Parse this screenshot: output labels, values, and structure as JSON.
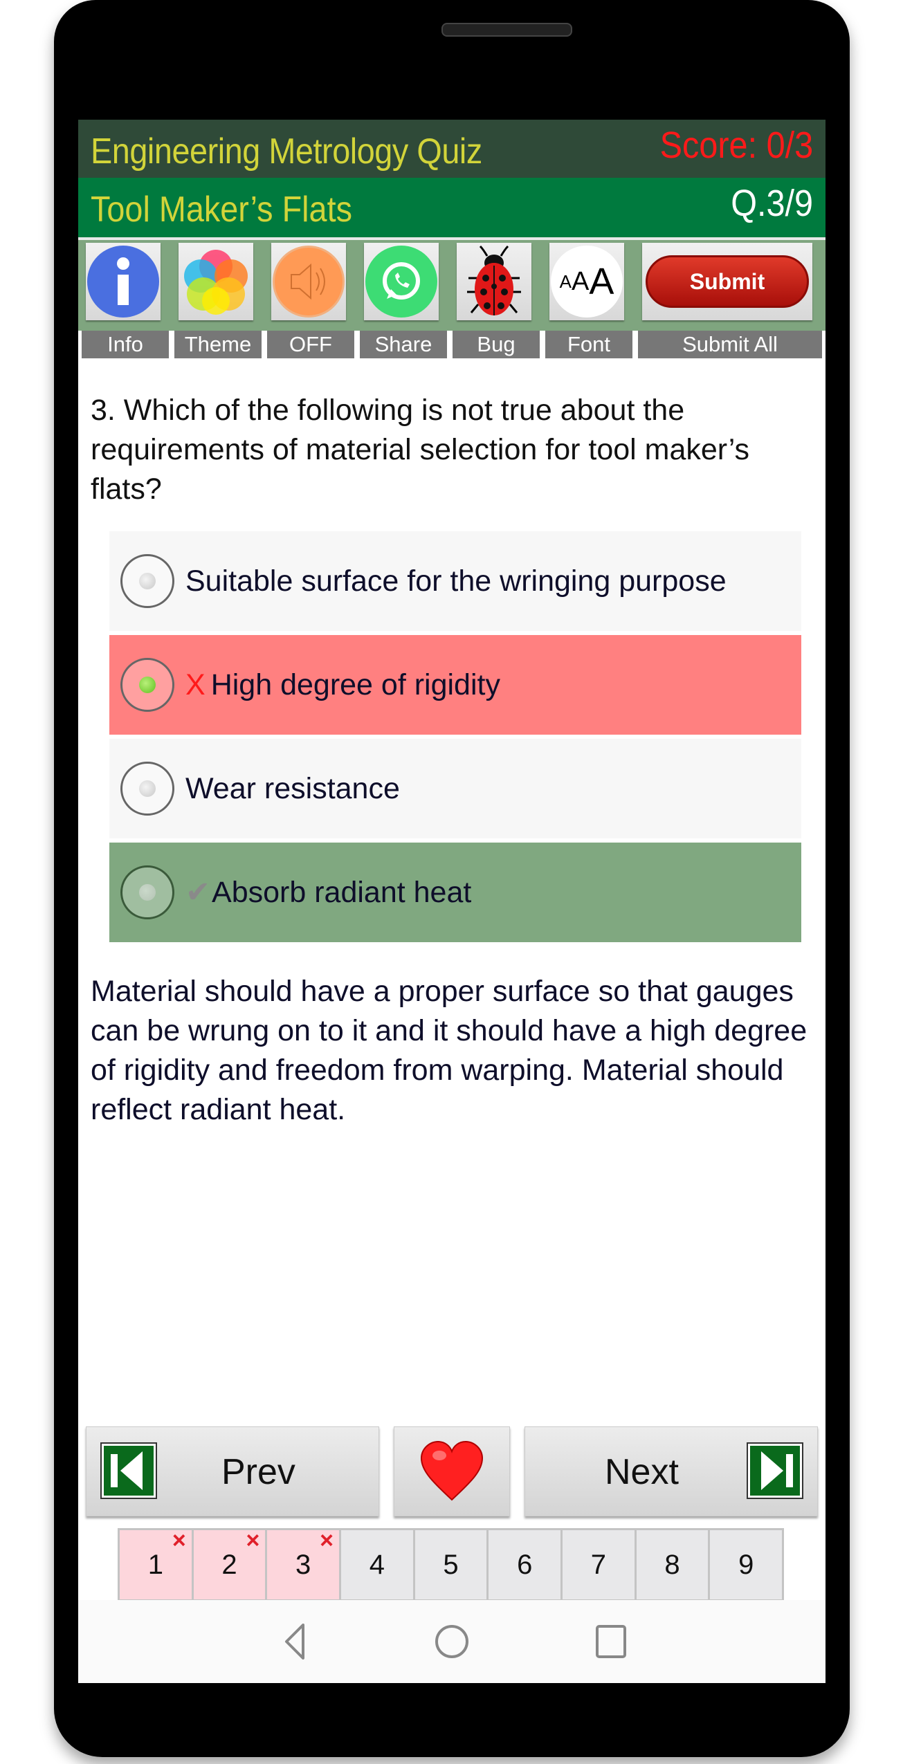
{
  "header": {
    "app_title": "Engineering Metrology Quiz",
    "score": "Score: 0/3",
    "topic": "Tool Maker’s Flats",
    "question_counter": "Q.3/9"
  },
  "toolbar": {
    "items": [
      {
        "label": "Info",
        "icon": "info-icon"
      },
      {
        "label": "Theme",
        "icon": "theme-palette-icon"
      },
      {
        "label": "OFF",
        "icon": "speaker-icon"
      },
      {
        "label": "Share",
        "icon": "whatsapp-icon"
      },
      {
        "label": "Bug",
        "icon": "ladybug-icon"
      },
      {
        "label": "Font",
        "icon": "font-size-icon"
      }
    ],
    "font_icon_text": "AAA",
    "submit_button": "Submit",
    "submit_all_label": "Submit All"
  },
  "question": {
    "text": "3. Which of the following is not true about the requirements of material selection for tool maker’s flats?"
  },
  "options": [
    {
      "text": "Suitable surface for the wringing purpose",
      "state": "neutral",
      "selected": false,
      "mark": ""
    },
    {
      "text": "High degree of rigidity",
      "state": "wrong",
      "selected": true,
      "mark": "X"
    },
    {
      "text": "Wear resistance",
      "state": "neutral",
      "selected": false,
      "mark": ""
    },
    {
      "text": "Absorb radiant heat",
      "state": "correct",
      "selected": false,
      "mark": "✔"
    }
  ],
  "explanation": "Material should have a proper surface so that gauges can be wrung on to it and it should have a high degree of rigidity and freedom from warping. Material should reflect radiant heat.",
  "navigation": {
    "prev_label": "Prev",
    "next_label": "Next"
  },
  "pages": [
    {
      "label": "1",
      "status": "wrong",
      "mark": "×"
    },
    {
      "label": "2",
      "status": "wrong",
      "mark": "×"
    },
    {
      "label": "3",
      "status": "wrong",
      "mark": "×"
    },
    {
      "label": "4",
      "status": "unanswered",
      "mark": ""
    },
    {
      "label": "5",
      "status": "unanswered",
      "mark": ""
    },
    {
      "label": "6",
      "status": "unanswered",
      "mark": ""
    },
    {
      "label": "7",
      "status": "unanswered",
      "mark": ""
    },
    {
      "label": "8",
      "status": "unanswered",
      "mark": ""
    },
    {
      "label": "9",
      "status": "unanswered",
      "mark": ""
    }
  ],
  "colors": {
    "header_dark": "#2f4a38",
    "header_green": "#007a3e",
    "title_yellow": "#d2d43a",
    "score_red": "#ff1a1a",
    "wrong_bg": "#ff8080",
    "correct_bg": "#80a880",
    "neutral_bg": "#f7f7f7"
  }
}
